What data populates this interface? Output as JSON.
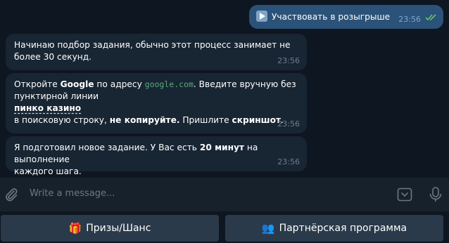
{
  "outgoing": {
    "text": "Участвовать в розыгрыше",
    "time": "23:56",
    "icon": "play-button-icon"
  },
  "messages": [
    {
      "line1": "Начинаю подбор задания, обычно этот процесс занимает не",
      "line2": "более 30 секунд.",
      "time": "23:56"
    },
    {
      "prefix": "Откройте ",
      "brand": "Google",
      "mid": " по адресу ",
      "url": "google.com",
      "after_url": ". Введите вручную без",
      "line2": "пунктирной линии",
      "query": "пинко казино",
      "line4_start": "в поисковую строку, ",
      "no_copy": "не копируйте.",
      "line4_mid": " Пришлите ",
      "screenshot": "скриншот",
      "line4_end": ".",
      "time": "23:56"
    },
    {
      "prefix": "Я подготовил новое задание. У Вас есть ",
      "duration": "20 минут",
      "suffix": " на выполнение",
      "line2": "каждого шага.",
      "time": "23:56"
    }
  ],
  "composer": {
    "placeholder": "Write a message...",
    "attach_icon": "paperclip-icon",
    "keyboard_icon": "bot-keyboard-icon",
    "mic_icon": "microphone-icon"
  },
  "keyboard": {
    "buttons": [
      {
        "emoji": "🎁",
        "label": "Призы/Шанс"
      },
      {
        "emoji": "👥",
        "label": "Партнёрская программа"
      }
    ]
  },
  "colors": {
    "background": "#0e1621",
    "incoming_bubble": "#182533",
    "outgoing_bubble": "#2b5278",
    "composer": "#17212b",
    "keyboard_button": "#2b3a4a",
    "link_green": "#5aa97a",
    "read_ticks": "#6ac36a"
  }
}
